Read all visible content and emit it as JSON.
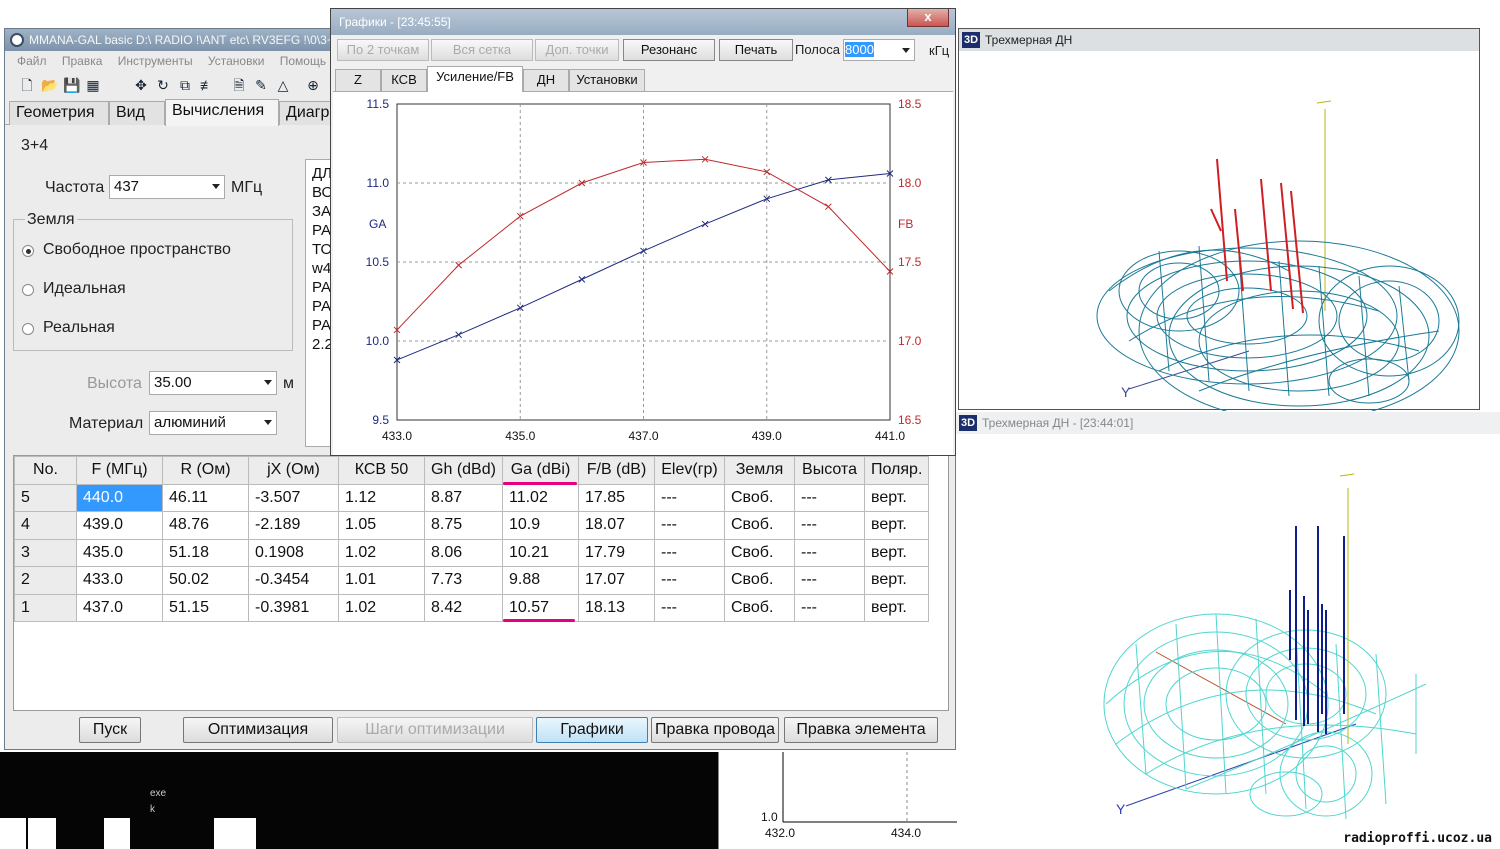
{
  "main": {
    "title": "MMANA-GAL basic D:\\ RADIO !\\ANT etc\\ RV3EFG !\\0\\3+",
    "menu": [
      "Файл",
      "Правка",
      "Инструменты",
      "Установки",
      "Помощь"
    ],
    "tabs": [
      "Геометрия",
      "Вид",
      "Вычисления",
      "Диагр"
    ],
    "active_tab": "Вычисления",
    "name": "3+4",
    "freq_label": "Частота",
    "freq_value": "437",
    "freq_unit": "МГц",
    "earth_label": "Земля",
    "earth_options": [
      "Свободное пространство",
      "Идеальная",
      "Реальная"
    ],
    "height_label": "Высота",
    "height_value": "35.00",
    "height_unit": "м",
    "material_label": "Материал",
    "material_value": "алюминий",
    "memo_lines": [
      "ДЛ",
      "ВО",
      "ЗА",
      "РА",
      "ТО",
      "w4",
      "РА",
      "РА",
      "РА",
      "2.2"
    ],
    "table": {
      "headers": [
        "No.",
        "F (МГц)",
        "R (Ом)",
        "jX (Ом)",
        "КСВ 50",
        "Gh (dBd)",
        "Ga (dBi)",
        "F/B (dB)",
        "Elev(гр)",
        "Земля",
        "Высота",
        "Поляр."
      ],
      "rows": [
        [
          "5",
          "440.0",
          "46.11",
          "-3.507",
          "1.12",
          "8.87",
          "11.02",
          "17.85",
          "---",
          "Своб.",
          "---",
          "верт."
        ],
        [
          "4",
          "439.0",
          "48.76",
          "-2.189",
          "1.05",
          "8.75",
          "10.9",
          "18.07",
          "---",
          "Своб.",
          "---",
          "верт."
        ],
        [
          "3",
          "435.0",
          "51.18",
          "0.1908",
          "1.02",
          "8.06",
          "10.21",
          "17.79",
          "---",
          "Своб.",
          "---",
          "верт."
        ],
        [
          "2",
          "433.0",
          "50.02",
          "-0.3454",
          "1.01",
          "7.73",
          "9.88",
          "17.07",
          "---",
          "Своб.",
          "---",
          "верт."
        ],
        [
          "1",
          "437.0",
          "51.15",
          "-0.3981",
          "1.02",
          "8.42",
          "10.57",
          "18.13",
          "---",
          "Своб.",
          "---",
          "верт."
        ]
      ]
    },
    "buttons": {
      "start": "Пуск",
      "optimize": "Оптимизация",
      "opt_steps": "Шаги оптимизации",
      "graphs": "Графики",
      "edit_wire": "Правка провода",
      "edit_element": "Правка элемента"
    }
  },
  "graphs_window": {
    "title": "Графики - [23:45:55]",
    "close": "x",
    "buttons": [
      "По 2 точкам",
      "Вся сетка",
      "Доп. точки",
      "Резонанс",
      "Печать"
    ],
    "band_label": "Полоса",
    "band_value": "8000",
    "band_unit": "кГц",
    "tabs": [
      "Z",
      "КСВ",
      "Усиление/FB",
      "ДН",
      "Установки"
    ],
    "active_tab": "Усиление/FB"
  },
  "chart_data": {
    "type": "line",
    "x": [
      433.0,
      434.0,
      435.0,
      436.0,
      437.0,
      438.0,
      439.0,
      440.0,
      441.0
    ],
    "xlim": [
      433.0,
      441.0
    ],
    "x_ticks": [
      "433.0",
      "435.0",
      "437.0",
      "439.0",
      "441.0"
    ],
    "series": [
      {
        "name": "GA",
        "axis": "left",
        "color": "#1e2a80",
        "values": [
          9.88,
          10.04,
          10.21,
          10.39,
          10.57,
          10.74,
          10.9,
          11.02,
          11.06
        ]
      },
      {
        "name": "FB",
        "axis": "right",
        "color": "#c0282d",
        "values": [
          17.07,
          17.48,
          17.79,
          18.0,
          18.13,
          18.15,
          18.07,
          17.85,
          17.44
        ]
      }
    ],
    "ylim_left": [
      9.5,
      11.5
    ],
    "y_ticks_left": [
      "11.5",
      "11.0",
      "10.5",
      "10.0",
      "9.5"
    ],
    "ylim_right": [
      16.5,
      18.5
    ],
    "y_ticks_right": [
      "18.5",
      "18.0",
      "17.5",
      "17.0",
      "16.5"
    ],
    "grid": true
  },
  "win3d_top": {
    "title": "Трехмерная ДН",
    "badge": "3D"
  },
  "win3d_bottom": {
    "title": "Трехмерная ДН - [23:44:01]",
    "badge": "3D"
  },
  "bg_chart": {
    "y_tick": "1.0",
    "x_ticks": [
      "432.0",
      "434.0"
    ]
  },
  "dark_text": [
    "exe",
    "k"
  ],
  "watermark": "radioproffi.ucoz.ua",
  "colors": {
    "ga": "#1e2a80",
    "fb": "#c0282d",
    "mesh_top": "#1a7a96",
    "mesh_bottom": "#4fd6cf",
    "highlight": "#e6007e",
    "selected_cell": "#3399ff"
  }
}
